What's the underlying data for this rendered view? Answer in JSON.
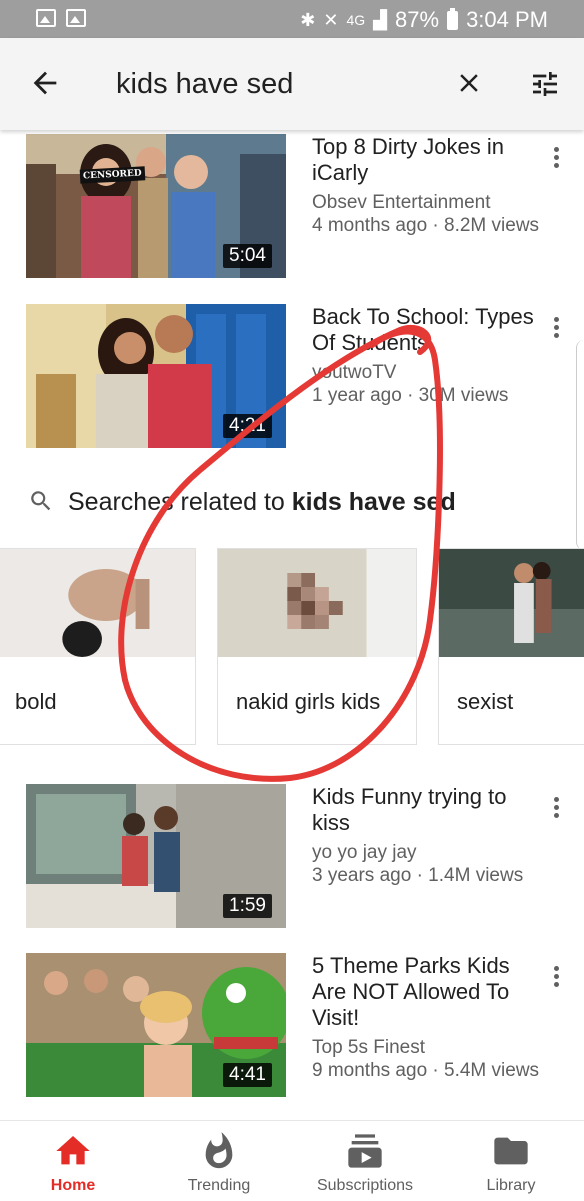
{
  "status_bar": {
    "battery": "87%",
    "time": "3:04 PM",
    "network": "4G"
  },
  "search": {
    "query": "kids have sed"
  },
  "videos": [
    {
      "title": "Top 8 Dirty Jokes in iCarly",
      "channel": "Obsev Entertainment",
      "stats": "4 months ago · 8.2M views",
      "duration": "5:04",
      "badge": "CENSORED"
    },
    {
      "title": "Back To School: Types Of Students",
      "channel": "youtwoTV",
      "stats": "1 year ago · 30M views",
      "duration": "4:21"
    },
    {
      "title": "Kids Funny trying to kiss",
      "channel": "yo yo jay jay",
      "stats": "3 years ago · 1.4M views",
      "duration": "1:59"
    },
    {
      "title": "5 Theme Parks Kids Are NOT Allowed To Visit!",
      "channel": "Top 5s Finest",
      "stats": "9 months ago · 5.4M views",
      "duration": "4:41"
    }
  ],
  "related": {
    "prefix": "Searches related to ",
    "query": "kids have sed",
    "cards": [
      {
        "label": "bold"
      },
      {
        "label": "nakid girls kids"
      },
      {
        "label": "sexist"
      }
    ]
  },
  "nav": {
    "items": [
      {
        "label": "Home",
        "icon": "home-icon",
        "active": true
      },
      {
        "label": "Trending",
        "icon": "flame-icon",
        "active": false
      },
      {
        "label": "Subscriptions",
        "icon": "subscriptions-icon",
        "active": false
      },
      {
        "label": "Library",
        "icon": "folder-icon",
        "active": false
      }
    ]
  },
  "colors": {
    "accent": "#e52d27",
    "annotation": "#e53935",
    "status_bar": "#9e9e9e",
    "search_bar": "#f4f4f4",
    "meta_text": "#606060"
  }
}
